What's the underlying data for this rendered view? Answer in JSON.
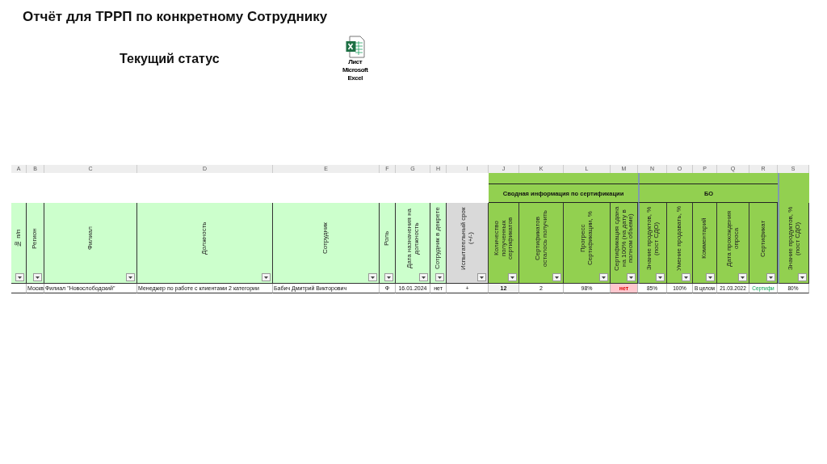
{
  "slide": {
    "title": "Отчёт для ТРРП по конкретному Сотруднику",
    "subtitle": "Текущий статус",
    "attachment": {
      "label": "Лист Microsoft Excel"
    }
  },
  "sheet": {
    "column_sets": [
      {
        "shaded": false,
        "columns": [
          {
            "letter": "A",
            "header": "№ п/п",
            "color": "#ccffcc"
          },
          {
            "letter": "B",
            "header": "Регион",
            "color": "#ccffcc"
          },
          {
            "letter": "C",
            "header": "Филиал",
            "color": "#ccffcc"
          },
          {
            "letter": "D",
            "header": "Должность",
            "color": "#ccffcc"
          },
          {
            "letter": "E",
            "header": "Сотрудник",
            "color": "#ccffcc"
          },
          {
            "letter": "F",
            "header": "Роль",
            "color": "#ccffcc"
          },
          {
            "letter": "G",
            "header": "Дата назначения на должность",
            "color": "#ccffcc"
          },
          {
            "letter": "H",
            "header": "Сотрудник в декрете",
            "color": "#ccffcc"
          },
          {
            "letter": "I",
            "header": "Испытательный срок (+/-)",
            "color": "#d9d9d9"
          }
        ]
      },
      {
        "shaded": true,
        "label": "Сводная информация по сертификации",
        "columns": [
          {
            "letter": "J",
            "header": "Количество полученных сертификатов",
            "color": "#92d050"
          },
          {
            "letter": "K",
            "header": "Сертификатов осталось получить",
            "color": "#92d050"
          },
          {
            "letter": "L",
            "header": "Прогресс Сертификации, %",
            "color": "#92d050"
          },
          {
            "letter": "M",
            "header": "Сертификация сдана на 100% (на дату в полном объеме)",
            "color": "#92d050"
          }
        ]
      },
      {
        "shaded": true,
        "label": "БО",
        "columns": [
          {
            "letter": "N",
            "header": "Знание продуктов, % (пост СДО)",
            "color": "#92d050"
          },
          {
            "letter": "O",
            "header": "Умение продавать, %",
            "color": "#92d050"
          },
          {
            "letter": "P",
            "header": "Комментарий",
            "color": "#92d050"
          },
          {
            "letter": "Q",
            "header": "Дата прохождения опроса",
            "color": "#92d050"
          },
          {
            "letter": "R",
            "header": "Сертификат",
            "color": "#92d050"
          }
        ]
      },
      {
        "shaded": true,
        "columns": [
          {
            "letter": "S",
            "header": "Знание продуктов, % (пост СДО)",
            "color": "#92d050"
          }
        ]
      }
    ],
    "rows": [
      {
        "cells": [
          {
            "text": "",
            "kind": "plain"
          },
          {
            "text": "Москв",
            "kind": "plain"
          },
          {
            "text": "Филиал \"Новослободский\"",
            "kind": "plain"
          },
          {
            "text": "Менеджер по работе с клиентами 2 категории",
            "kind": "plain"
          },
          {
            "text": "Бабич Дмитрий Викторович",
            "kind": "plain"
          },
          {
            "text": "Ф",
            "kind": "center"
          },
          {
            "text": "16.01.2024",
            "kind": "center"
          },
          {
            "text": "нет",
            "kind": "center"
          },
          {
            "text": "+",
            "kind": "center"
          },
          {
            "text": "12",
            "kind": "shaded"
          },
          {
            "text": "2",
            "kind": "center"
          },
          {
            "text": "98%",
            "kind": "center"
          },
          {
            "text": "нет",
            "kind": "alert"
          },
          {
            "text": "85%",
            "kind": "small"
          },
          {
            "text": "100%",
            "kind": "small"
          },
          {
            "text": "В целом",
            "kind": "small"
          },
          {
            "text": "21.03.2022",
            "kind": "small"
          },
          {
            "text": "Сертифи",
            "kind": "positive"
          },
          {
            "text": "80%",
            "kind": "small"
          }
        ]
      }
    ]
  }
}
